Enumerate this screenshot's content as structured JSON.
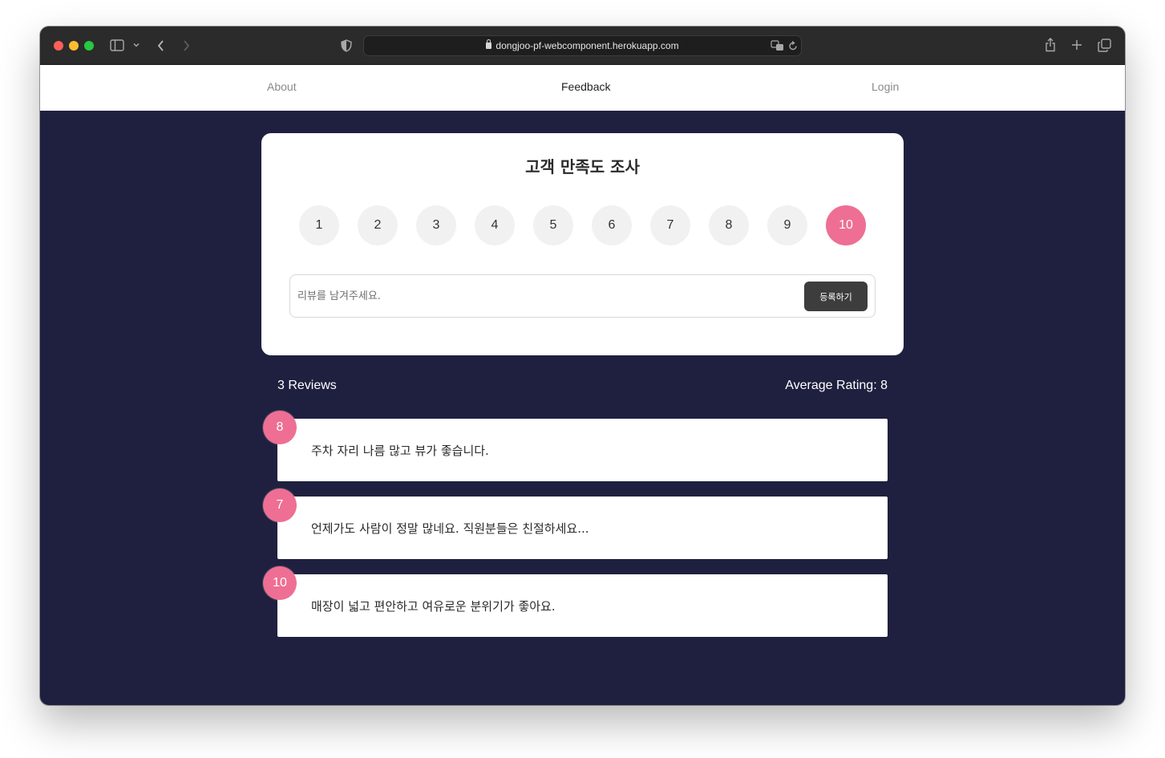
{
  "browser": {
    "url": "dongjoo-pf-webcomponent.herokuapp.com"
  },
  "nav": {
    "about": "About",
    "feedback": "Feedback",
    "login": "Login"
  },
  "survey": {
    "title": "고객 만족도 조사",
    "ratings": [
      "1",
      "2",
      "3",
      "4",
      "5",
      "6",
      "7",
      "8",
      "9",
      "10"
    ],
    "selected_rating": "10",
    "input_placeholder": "리뷰를 남겨주세요.",
    "input_value": "",
    "submit_label": "등록하기"
  },
  "stats": {
    "count_label": "3 Reviews",
    "average_label": "Average Rating: 8"
  },
  "reviews": [
    {
      "rating": "8",
      "text": "주차 자리 나름 많고 뷰가 좋습니다."
    },
    {
      "rating": "7",
      "text": "언제가도 사람이 정말 많네요. 직원분들은 친절하세요..."
    },
    {
      "rating": "10",
      "text": "매장이 넓고 편안하고 여유로운 분위기가 좋아요."
    }
  ],
  "colors": {
    "page_background": "#1f203f",
    "accent_pink": "#ee6f93",
    "submit_button": "#3d3d3d"
  },
  "icons": {
    "titlebar": [
      "sidebar-icon",
      "chevron-down-icon",
      "back-icon",
      "forward-icon",
      "shield-icon",
      "lock-icon",
      "translate-icon",
      "reload-icon",
      "share-icon",
      "plus-icon",
      "tabs-icon"
    ]
  }
}
